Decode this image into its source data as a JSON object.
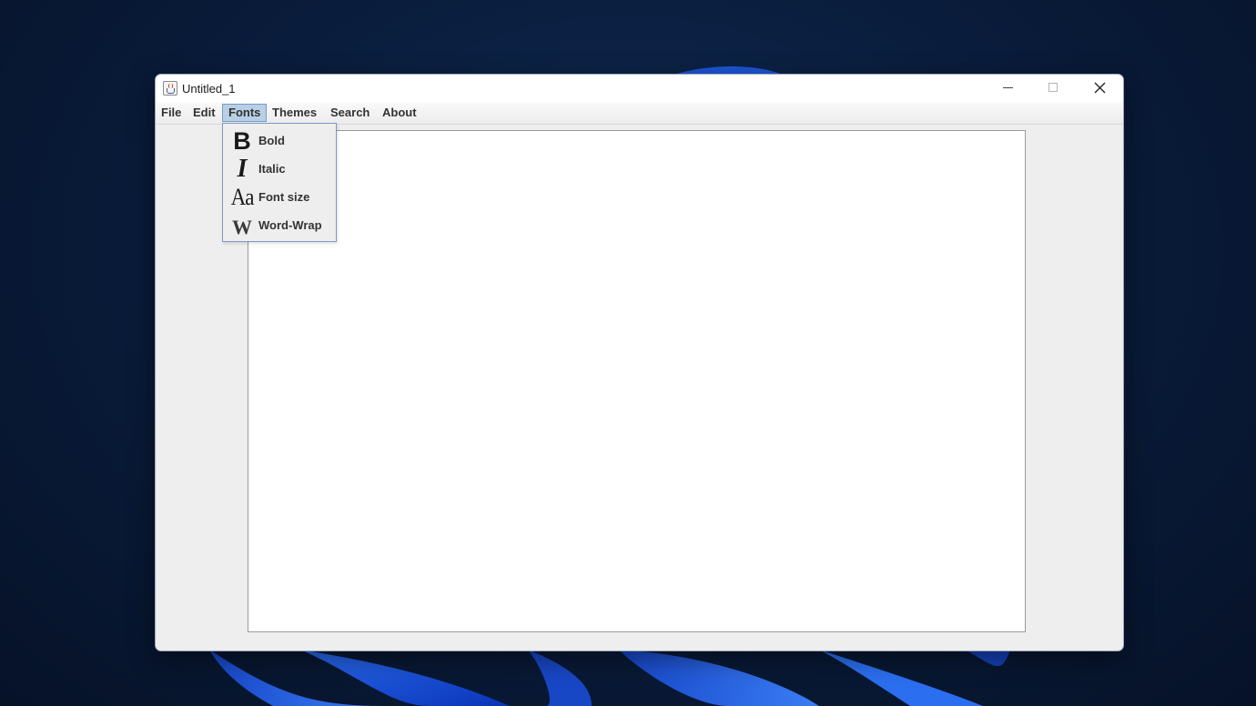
{
  "window": {
    "title": "Untitled_1"
  },
  "title_controls": {
    "minimize": "minimize-icon",
    "maximize": "maximize-icon",
    "close": "close-icon"
  },
  "menubar": {
    "file": "File",
    "edit": "Edit",
    "fonts": "Fonts",
    "themes": "Themes",
    "search": "Search",
    "about": "About",
    "active_menu": "Fonts"
  },
  "fonts_menu": {
    "items": [
      {
        "label": "Bold",
        "icon": "bold-icon",
        "glyph": "B"
      },
      {
        "label": "Italic",
        "icon": "italic-icon",
        "glyph": "I"
      },
      {
        "label": "Font size",
        "icon": "font-size-icon",
        "glyph": "Aa"
      },
      {
        "label": "Word-Wrap",
        "icon": "word-wrap-icon",
        "glyph": "W"
      }
    ]
  },
  "editor": {
    "text": ""
  },
  "colors": {
    "menu_highlight": "#b8cfe5",
    "menu_highlight_border": "#7a9cc2",
    "window_bg": "#eeeeee",
    "desktop_bg": "#0a1d3d",
    "wallpaper_accent": "#1b5be0"
  }
}
